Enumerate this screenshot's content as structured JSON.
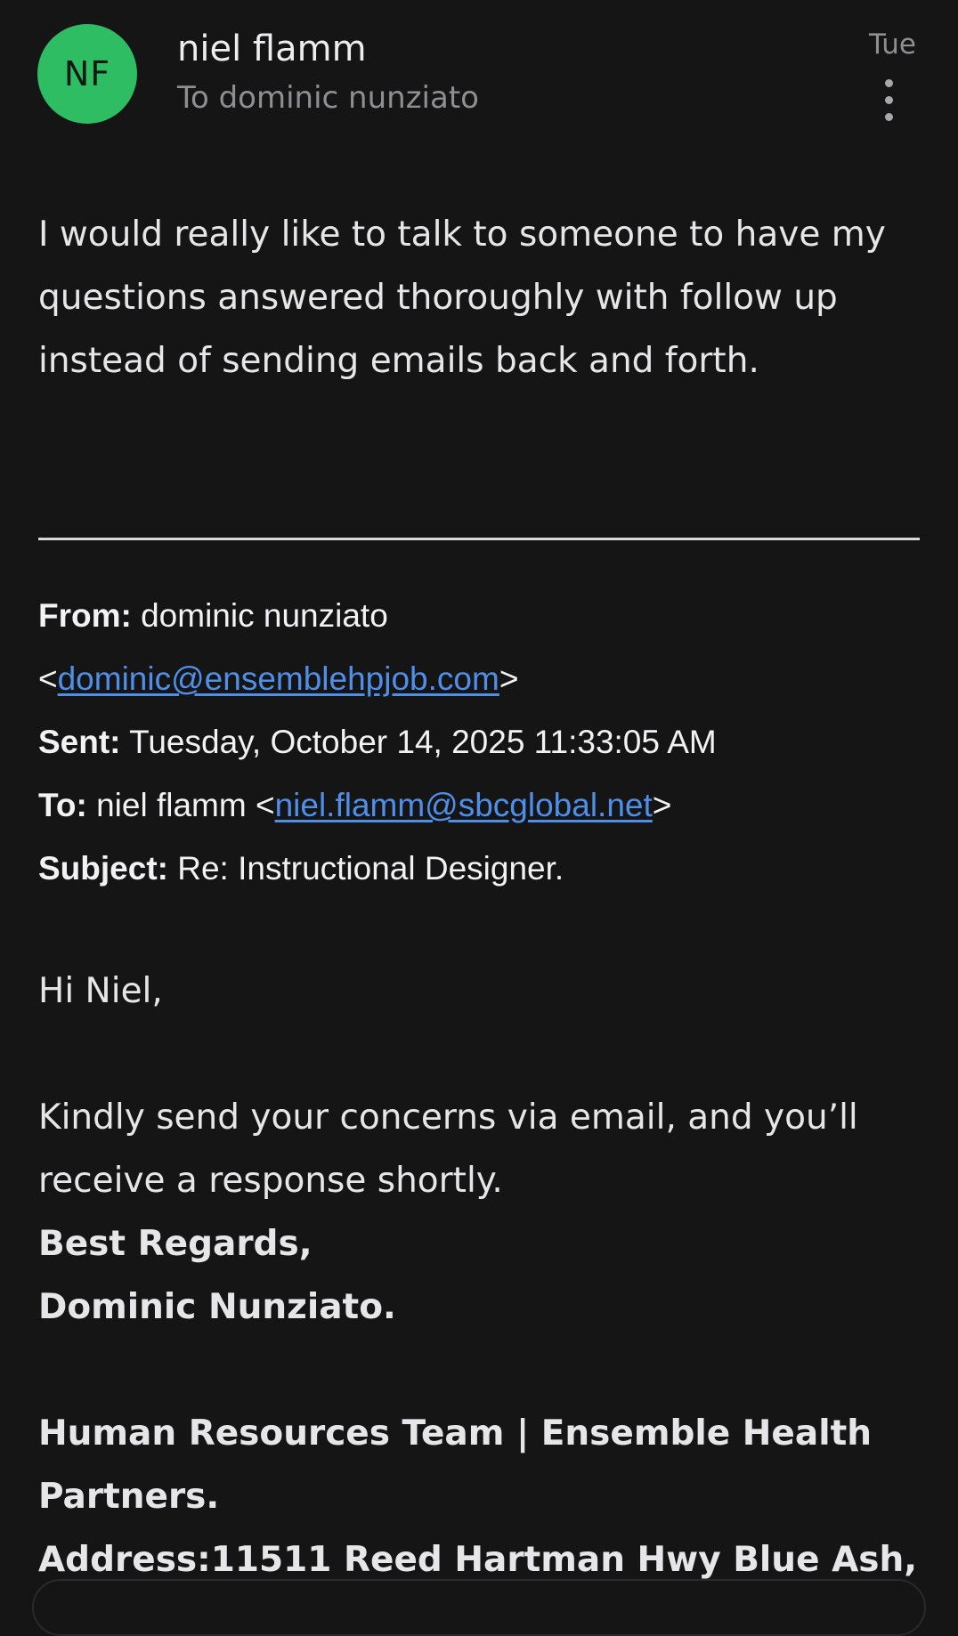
{
  "header": {
    "avatar_initials": "NF",
    "avatar_color": "#2ebd63",
    "sender_name": "niel flamm",
    "recipient_line": "To dominic nunziato",
    "date": "Tue",
    "more_icon": "more-vertical-icon"
  },
  "reply": {
    "body": "I would really like to talk to someone to have my questions answered thoroughly with follow up instead of sending emails back and forth."
  },
  "quoted": {
    "from_label": "From:",
    "from_name": "dominic nunziato",
    "from_email": "dominic@ensemblehpjob.com",
    "sent_label": "Sent:",
    "sent_value": "Tuesday, October 14, 2025 11:33:05 AM",
    "to_label": "To:",
    "to_name": "niel flamm",
    "to_email": "niel.flamm@sbcglobal.net",
    "subject_label": "Subject:",
    "subject_value": "Re: Instructional Designer.",
    "link_color": "#4f8fe8"
  },
  "quoted_body": {
    "greeting": "Hi Niel,",
    "message": "Kindly send your concerns via email, and you’ll receive a response shortly.",
    "closing": "Best Regards,",
    "signature_name": "Dominic Nunziato.",
    "team_line": "Human Resources Team | Ensemble Health Partners.",
    "address_line": "Address:11511 Reed Hartman Hwy Blue Ash,"
  }
}
